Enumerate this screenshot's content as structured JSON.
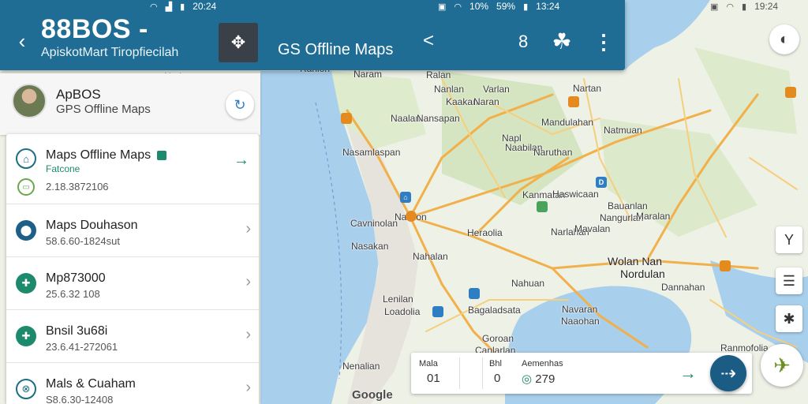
{
  "status": {
    "left_time": "20:24",
    "right_battery": "10%",
    "right_signal": "59%",
    "right_time": "13:24",
    "far_time": "19:24"
  },
  "appbar": {
    "title": "88BOS -",
    "subtitle": "ApiskotMart Tiropfiecilah",
    "center_title": "GS Offline Maps",
    "caret": "<",
    "number": "8",
    "back_glyph": "‹",
    "more_glyph": "⋮",
    "layers_glyph": "✥",
    "map_icon_glyph": "☘"
  },
  "profile": {
    "name": "ApBOS",
    "subtitle": "GPS Offline Maps"
  },
  "list": [
    {
      "title": "Maps Offline Maps",
      "tag": "Fatcone",
      "sub": "2.18.3872106",
      "icon": "⌂",
      "trailing": "→"
    },
    {
      "title": "Maps Douhason",
      "sub": "58.6.60-1824sut",
      "icon": "⬤",
      "trailing": "›"
    },
    {
      "title": "Mp873000",
      "sub": "25.6.32 108",
      "icon": "✚",
      "trailing": "›"
    },
    {
      "title": "Bnsil 3u68i",
      "sub": "23.6.41-272061",
      "icon": "✚",
      "trailing": "›"
    },
    {
      "title": "Mals & Cuaham",
      "sub": "S8.6.30-12408",
      "icon": "⊗",
      "trailing": "›"
    }
  ],
  "route_card": {
    "col1_label": "Mala",
    "col1_value": "01",
    "col2_label": "Bhl",
    "col2_value": "0",
    "col3_label": "Aemenhas",
    "col3_value": "279"
  },
  "map": {
    "google": "Google",
    "labels": [
      "Narlan",
      "Kanlon",
      "Ranlon",
      "Naram",
      "Ralan",
      "Nanlan",
      "Nartan",
      "Varlan",
      "Kaakan",
      "Naran",
      "Naalan",
      "Nansapan",
      "Mandulahan",
      "Natmuan",
      "Napl",
      "Naabilan",
      "Naruthan",
      "Nasamlaspan",
      "Kanmatan",
      "Haswicaan",
      "Bauanlan",
      "Nangurlan",
      "Naalion",
      "Cavninolan",
      "Nasakan",
      "Nahalan",
      "Heraolia",
      "Narlahan",
      "Maralan",
      "Wolan Nan",
      "Nordulan",
      "Mavalan",
      "Nahuan",
      "Dannahan",
      "Lenilan",
      "Loadolia",
      "Bagaladsata",
      "Navaran",
      "Naaohan",
      "Goroan",
      "Canlarlan",
      "Ranmofolia",
      "Nenalian"
    ]
  },
  "colors": {
    "appbar": "#1f6d95",
    "accent_green": "#1d8a6e",
    "go_button": "#1a5c83",
    "water": "#a8cfec"
  }
}
